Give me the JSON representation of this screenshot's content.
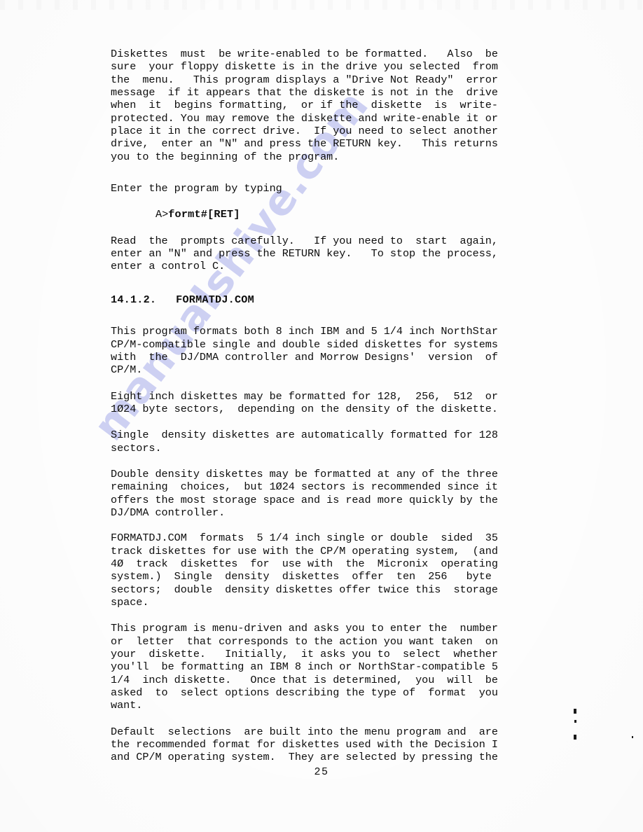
{
  "document": {
    "page_number": "25",
    "watermark_text": "manualshive.com",
    "watermark_color": "#9aa0e8",
    "background_color": "#fdfdfd",
    "text_color": "#0d0d0d"
  },
  "body": {
    "paragraph_1": "Diskettes  must  be write-enabled to be formatted.   Also  be\nsure  your floppy diskette is in the drive you selected  from\nthe  menu.   This program displays a \"Drive Not Ready\"  error\nmessage  if it appears that the diskette is not in the  drive\nwhen  it  begins formatting,  or if the  diskette  is  write-\nprotected. You may remove the diskette and write-enable it or\nplace it in the correct drive.  If you need to select another\ndrive,  enter an \"N\" and press the RETURN key.   This returns\nyou to the beginning of the program.",
    "paragraph_2": "Enter the program by typing",
    "command": {
      "prompt": "A>",
      "text": "formt#[RET]"
    },
    "paragraph_3": "Read  the  prompts carefully.   If you need to  start  again,\nenter an \"N\" and press the RETURN key.   To stop the process,\nenter a control C.",
    "section_heading": "14.1.2.   FORMATDJ.COM",
    "paragraph_4": "This program formats both 8 inch IBM and 5 1/4 inch NorthStar\nCP/M-compatible single and double sided diskettes for systems\nwith  the  DJ/DMA controller and Morrow Designs'  version  of\nCP/M.",
    "paragraph_5": "Eight inch diskettes may be formatted for 128,  256,  512  or\n1Ø24 byte sectors,  depending on the density of the diskette.",
    "paragraph_6": "Single  density diskettes are automatically formatted for 128\nsectors.",
    "paragraph_7": "Double density diskettes may be formatted at any of the three\nremaining  choices,  but 1Ø24 sectors is recommended since it\noffers the most storage space and is read more quickly by the\nDJ/DMA controller.",
    "paragraph_8": "FORMATDJ.COM  formats  5 1/4 inch single or double  sided  35\ntrack diskettes for use with the CP/M operating system,  (and\n4Ø  track  diskettes  for  use with  the  Micronix  operating\nsystem.)  Single  density  diskettes  offer  ten  256   byte\nsectors;  double  density diskettes offer twice this  storage\nspace.",
    "paragraph_9": "This program is menu-driven and asks you to enter the  number\nor  letter  that corresponds to the action you want taken  on\nyour  diskette.   Initially,  it asks you to  select  whether\nyou'll  be formatting an IBM 8 inch or NorthStar-compatible 5\n1/4  inch diskette.   Once that is determined,  you  will  be\nasked  to  select options describing the type of  format  you\nwant.",
    "paragraph_10": "Default  selections  are built into the menu program and  are\nthe recommended format for diskettes used with the Decision I\nand CP/M operating system.  They are selected by pressing the"
  }
}
